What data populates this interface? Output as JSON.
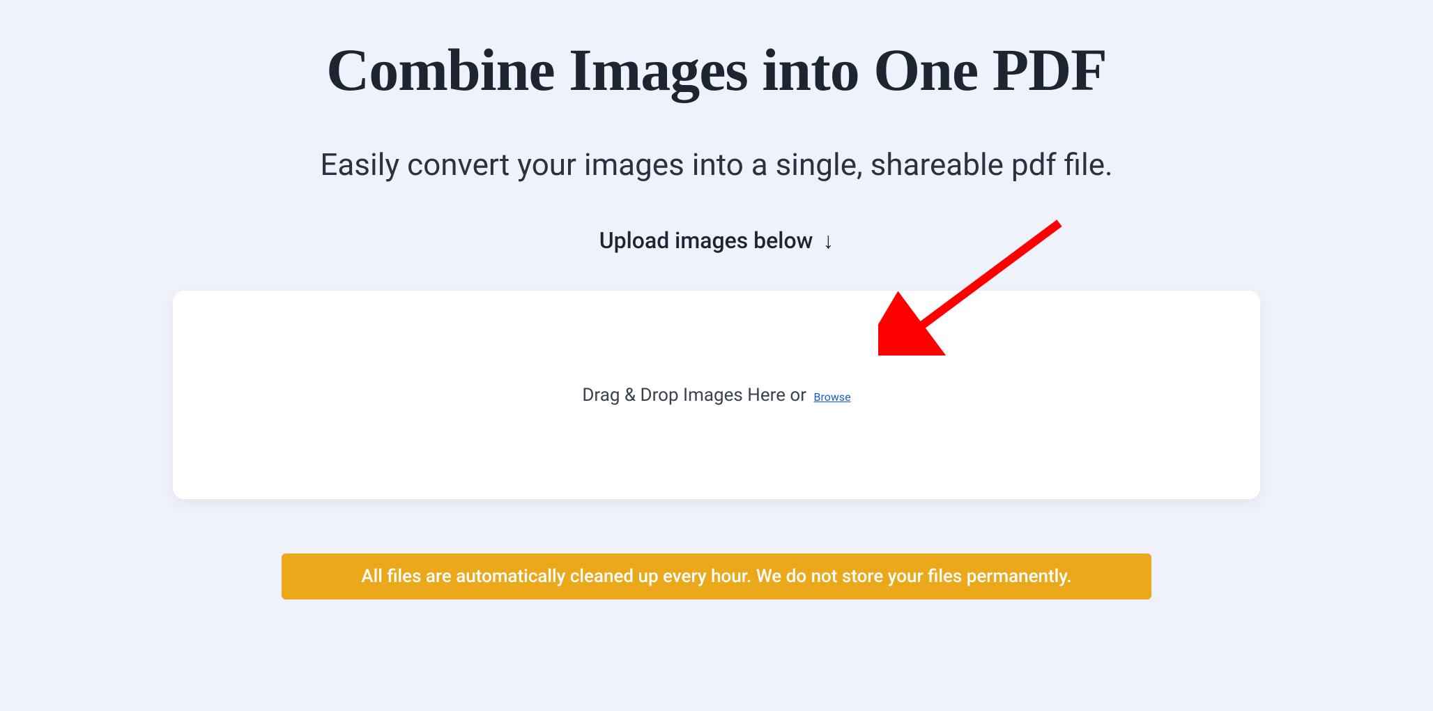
{
  "page": {
    "title": "Combine Images into One PDF",
    "subtitle": "Easily convert your images into a single, shareable pdf file.",
    "upload_instruction": "Upload images below",
    "down_arrow": "↓"
  },
  "dropzone": {
    "text": "Drag & Drop Images Here or ",
    "browse_label": "Browse"
  },
  "notice": {
    "text": "All files are automatically cleaned up every hour. We do not store your files permanently."
  },
  "colors": {
    "background": "#f0f2fb",
    "title": "#1e2532",
    "banner": "#eba81a",
    "link": "#1a5fd4",
    "dropzone_bg": "#ffffff",
    "arrow_annotation": "#ff0000"
  }
}
